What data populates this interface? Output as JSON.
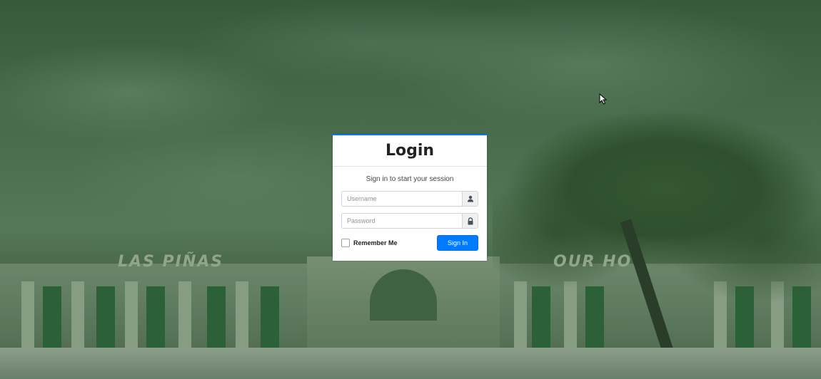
{
  "background": {
    "sign_left": "LAS PIÑAS",
    "sign_right": "OUR HO"
  },
  "login": {
    "title": "Login",
    "message": "Sign in to start your session",
    "username": {
      "placeholder": "Username",
      "value": "",
      "icon": "user-icon"
    },
    "password": {
      "placeholder": "Password",
      "value": "",
      "icon": "lock-icon"
    },
    "remember_label": "Remember Me",
    "remember_checked": false,
    "signin_label": "Sign In"
  },
  "colors": {
    "accent": "#007bff",
    "overlay": "#2f5a35"
  }
}
